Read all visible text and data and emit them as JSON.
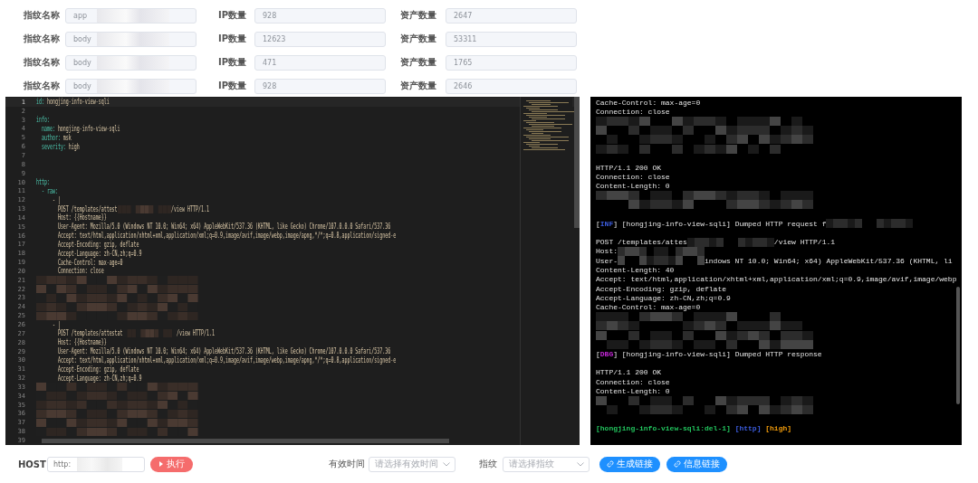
{
  "stats": [
    {
      "name_label": "指纹名称",
      "name_value": "app",
      "ip_label": "IP数量",
      "ip_value": "928",
      "asset_label": "资产数量",
      "asset_value": "2647"
    },
    {
      "name_label": "指纹名称",
      "name_value": "body",
      "ip_label": "IP数量",
      "ip_value": "12623",
      "asset_label": "资产数量",
      "asset_value": "53311"
    },
    {
      "name_label": "指纹名称",
      "name_value": "body",
      "ip_label": "IP数量",
      "ip_value": "471",
      "asset_label": "资产数量",
      "asset_value": "1765"
    },
    {
      "name_label": "指纹名称",
      "name_value": "body",
      "ip_label": "IP数量",
      "ip_value": "928",
      "asset_label": "资产数量",
      "asset_value": "2646"
    }
  ],
  "editor": {
    "lines": [
      {
        "n": "1",
        "kind": "kv",
        "key": "id:",
        "value": "hongjing-info-view-sqli",
        "current": true
      },
      {
        "n": "2",
        "kind": "blank",
        "current": false
      },
      {
        "n": "3",
        "kind": "kv",
        "key": "info:",
        "current": false
      },
      {
        "n": "4",
        "kind": "kv",
        "key": "  name:",
        "value": "hongjing-info-view-sqli",
        "current": false
      },
      {
        "n": "5",
        "kind": "kv",
        "key": "  author:",
        "value": "msk",
        "current": false
      },
      {
        "n": "6",
        "kind": "kv",
        "key": "  severity:",
        "value": "high",
        "current": false
      },
      {
        "n": "7",
        "kind": "blank",
        "current": false
      },
      {
        "n": "8",
        "kind": "blank",
        "current": false
      },
      {
        "n": "9",
        "kind": "blank",
        "current": false
      },
      {
        "n": "10",
        "kind": "kv",
        "key": "http:",
        "current": false
      },
      {
        "n": "11",
        "kind": "kv",
        "key": "  - raw:",
        "current": false
      },
      {
        "n": "12",
        "kind": "text",
        "text": "      - |",
        "current": false
      },
      {
        "n": "13",
        "kind": "text",
        "text": "        POST /templates/attest",
        "tail": "/view HTTP/1.1",
        "current": false
      },
      {
        "n": "14",
        "kind": "text",
        "text": "        Host: {{Hostname}}",
        "current": false
      },
      {
        "n": "15",
        "kind": "text",
        "text": "        User-Agent: Mozilla/5.0 (Windows NT 10.0; Win64; x64) AppleWebKit/537.36 (KHTML, like Gecko) Chrome/107.0.0.0 Safari/537.36",
        "current": false
      },
      {
        "n": "16",
        "kind": "text",
        "text": "        Accept: text/html,application/xhtml+xml,application/xml;q=0.9,image/avif,image/webp,image/apng,*/*;q=0.8,application/signed-e",
        "current": false
      },
      {
        "n": "17",
        "kind": "text",
        "text": "        Accept-Encoding: gzip, deflate",
        "current": false
      },
      {
        "n": "18",
        "kind": "text",
        "text": "        Accept-Language: zh-CN,zh;q=0.9",
        "current": false
      },
      {
        "n": "19",
        "kind": "text",
        "text": "        Cache-Control: max-age=0",
        "current": false
      },
      {
        "n": "20",
        "kind": "text",
        "text": "        Connection: close",
        "current": false
      },
      {
        "n": "21",
        "kind": "redacted",
        "current": false
      },
      {
        "n": "22",
        "kind": "redacted",
        "current": false
      },
      {
        "n": "23",
        "kind": "redacted",
        "current": false
      },
      {
        "n": "24",
        "kind": "redacted",
        "current": false
      },
      {
        "n": "25",
        "kind": "redacted",
        "current": false
      },
      {
        "n": "26",
        "kind": "text",
        "text": "      - |",
        "current": false
      },
      {
        "n": "27",
        "kind": "text",
        "text": "        POST /templates/attestat",
        "tail": "/view HTTP/1.1",
        "current": false
      },
      {
        "n": "28",
        "kind": "text",
        "text": "        Host: {{Hostname}}",
        "current": false
      },
      {
        "n": "29",
        "kind": "text",
        "text": "        User-Agent: Mozilla/5.0 (Windows NT 10.0; Win64; x64) AppleWebKit/537.36 (KHTML, like Gecko) Chrome/107.0.0.0 Safari/537.36",
        "current": false
      },
      {
        "n": "30",
        "kind": "text",
        "text": "        Accept: text/html,application/xhtml+xml,application/xml;q=0.9,image/avif,image/webp,image/apng,*/*;q=0.8,application/signed-e",
        "current": false
      },
      {
        "n": "31",
        "kind": "text",
        "text": "        Accept-Encoding: gzip, deflate",
        "current": false
      },
      {
        "n": "32",
        "kind": "text",
        "text": "        Accept-Language: zh-CN,zh;q=0.9",
        "current": false
      },
      {
        "n": "33",
        "kind": "redacted",
        "current": false
      },
      {
        "n": "34",
        "kind": "redacted",
        "current": false
      },
      {
        "n": "35",
        "kind": "redacted",
        "current": false
      },
      {
        "n": "36",
        "kind": "redacted",
        "current": false
      },
      {
        "n": "37",
        "kind": "redacted",
        "current": false
      },
      {
        "n": "38",
        "kind": "redacted",
        "current": false
      },
      {
        "n": "39",
        "kind": "blank",
        "current": false
      }
    ]
  },
  "terminal": {
    "lines": [
      {
        "kind": "parts",
        "parts": [
          {
            "kind": "text",
            "text": "Cache-Control: max-age=0"
          }
        ]
      },
      {
        "kind": "parts",
        "parts": [
          {
            "kind": "text",
            "text": "Connection: close"
          }
        ]
      },
      {
        "kind": "redacted"
      },
      {
        "kind": "redacted"
      },
      {
        "kind": "redacted"
      },
      {
        "kind": "redacted"
      },
      {
        "kind": "blank"
      },
      {
        "kind": "parts",
        "parts": [
          {
            "kind": "text",
            "text": "HTTP/1.1 200 OK"
          }
        ]
      },
      {
        "kind": "parts",
        "parts": [
          {
            "kind": "text",
            "text": "Connection: close"
          }
        ]
      },
      {
        "kind": "parts",
        "parts": [
          {
            "kind": "text",
            "text": "Content-Length: 0"
          }
        ]
      },
      {
        "kind": "redacted"
      },
      {
        "kind": "redacted"
      },
      {
        "kind": "blank"
      },
      {
        "kind": "parts",
        "parts": [
          {
            "kind": "text",
            "text": "["
          },
          {
            "kind": "text",
            "text": "INF",
            "color": "#3b5bdb"
          },
          {
            "kind": "text",
            "text": "] [hongjing-info-view-sqli] Dumped HTTP request f"
          },
          {
            "kind": "redacted"
          }
        ]
      },
      {
        "kind": "blank"
      },
      {
        "kind": "parts",
        "parts": [
          {
            "kind": "text",
            "text": "POST /templates/attes"
          },
          {
            "kind": "redacted"
          },
          {
            "kind": "text",
            "text": "/view HTTP/1.1"
          }
        ]
      },
      {
        "kind": "parts",
        "parts": [
          {
            "kind": "text",
            "text": "Host:"
          },
          {
            "kind": "redacted"
          }
        ]
      },
      {
        "kind": "parts",
        "parts": [
          {
            "kind": "text",
            "text": "User-"
          },
          {
            "kind": "redacted"
          },
          {
            "kind": "text",
            "text": "indows NT 10.0; Win64; x64) AppleWebKit/537.36 (KHTML, li"
          }
        ]
      },
      {
        "kind": "parts",
        "parts": [
          {
            "kind": "text",
            "text": "Content-Length: 40"
          }
        ]
      },
      {
        "kind": "parts",
        "parts": [
          {
            "kind": "text",
            "text": "Accept: text/html,application/xhtml+xml,application/xml;q=0.9,image/avif,image/webp"
          }
        ]
      },
      {
        "kind": "parts",
        "parts": [
          {
            "kind": "text",
            "text": "Accept-Encoding: gzip, deflate"
          }
        ]
      },
      {
        "kind": "parts",
        "parts": [
          {
            "kind": "text",
            "text": "Accept-Language: zh-CN,zh;q=0.9"
          }
        ]
      },
      {
        "kind": "parts",
        "parts": [
          {
            "kind": "text",
            "text": "Cache-Control: max-age=0"
          }
        ]
      },
      {
        "kind": "redacted"
      },
      {
        "kind": "redacted"
      },
      {
        "kind": "redacted"
      },
      {
        "kind": "redacted"
      },
      {
        "kind": "parts",
        "parts": [
          {
            "kind": "text",
            "text": "["
          },
          {
            "kind": "text",
            "text": "DBG",
            "color": "#c026d3"
          },
          {
            "kind": "text",
            "text": "] [hongjing-info-view-sqli] Dumped HTTP response"
          }
        ]
      },
      {
        "kind": "blank"
      },
      {
        "kind": "parts",
        "parts": [
          {
            "kind": "text",
            "text": "HTTP/1.1 200 OK"
          }
        ]
      },
      {
        "kind": "parts",
        "parts": [
          {
            "kind": "text",
            "text": "Connection: close"
          }
        ]
      },
      {
        "kind": "parts",
        "parts": [
          {
            "kind": "text",
            "text": "Content-Length: 0"
          }
        ]
      },
      {
        "kind": "redacted"
      },
      {
        "kind": "redacted"
      },
      {
        "kind": "blank"
      },
      {
        "kind": "parts",
        "parts": [
          {
            "kind": "text",
            "text": "[hongjing-info-view-sqli:del-1]",
            "color": "#22c55e"
          },
          {
            "kind": "text",
            "text": "[http]",
            "color": "#3b5bdb"
          },
          {
            "kind": "text",
            "text": "[high]",
            "color": "#f59e0b"
          }
        ]
      }
    ]
  },
  "toolbar": {
    "host_label": "HOST",
    "host_value": "http:",
    "run_button": "执行",
    "time_label": "有效时间",
    "time_placeholder": "请选择有效时间",
    "fp_label": "指纹",
    "fp_placeholder": "请选择指纹",
    "buttons": [
      "生成链接",
      "信息链接"
    ]
  }
}
